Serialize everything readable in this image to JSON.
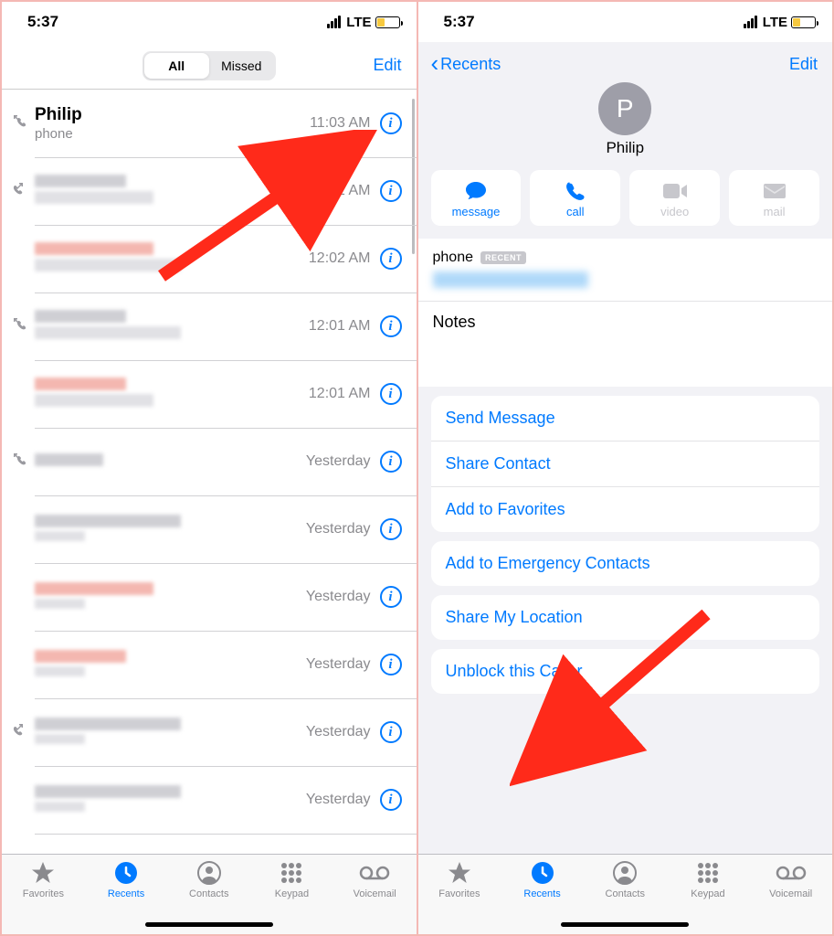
{
  "status": {
    "time": "5:37",
    "carrier": "LTE"
  },
  "left": {
    "segments": {
      "all": "All",
      "missed": "Missed"
    },
    "edit": "Edit",
    "calls": [
      {
        "name": "Philip",
        "sub": "phone",
        "time": "11:03 AM",
        "type": "in",
        "missed": false,
        "redacted": false
      },
      {
        "time": "12:02 AM",
        "type": "out",
        "missed": false,
        "redacted": true,
        "nameW": "w100",
        "subW": "w130"
      },
      {
        "time": "12:02 AM",
        "type": "",
        "missed": true,
        "redacted": true,
        "nameW": "w130",
        "subW": "w160"
      },
      {
        "time": "12:01 AM",
        "type": "in",
        "missed": false,
        "redacted": true,
        "nameW": "w100",
        "subW": "w160"
      },
      {
        "time": "12:01 AM",
        "type": "",
        "missed": true,
        "redacted": true,
        "nameW": "w100",
        "subW": "w130"
      },
      {
        "time": "Yesterday",
        "type": "in",
        "missed": false,
        "redacted": true,
        "nameW": "w75",
        "subW": ""
      },
      {
        "time": "Yesterday",
        "type": "",
        "missed": false,
        "redacted": true,
        "nameW": "w160",
        "subW": "sm"
      },
      {
        "time": "Yesterday",
        "type": "",
        "missed": true,
        "redacted": true,
        "nameW": "w130",
        "subW": "sm"
      },
      {
        "time": "Yesterday",
        "type": "",
        "missed": true,
        "redacted": true,
        "nameW": "w100",
        "subW": "sm"
      },
      {
        "time": "Yesterday",
        "type": "out",
        "missed": false,
        "redacted": true,
        "nameW": "w160",
        "subW": "sm"
      },
      {
        "time": "Yesterday",
        "type": "",
        "missed": false,
        "redacted": true,
        "nameW": "w160",
        "subW": "sm"
      }
    ]
  },
  "right": {
    "back": "Recents",
    "edit": "Edit",
    "avatarInitial": "P",
    "name": "Philip",
    "actions": {
      "message": "message",
      "call": "call",
      "video": "video",
      "mail": "mail"
    },
    "phoneLabel": "phone",
    "recentBadge": "RECENT",
    "notes": "Notes",
    "menu1": [
      "Send Message",
      "Share Contact",
      "Add to Favorites"
    ],
    "menu2": [
      "Add to Emergency Contacts"
    ],
    "menu3": [
      "Share My Location"
    ],
    "menu4": [
      "Unblock this Caller"
    ]
  },
  "tabs": {
    "favorites": "Favorites",
    "recents": "Recents",
    "contacts": "Contacts",
    "keypad": "Keypad",
    "voicemail": "Voicemail"
  }
}
